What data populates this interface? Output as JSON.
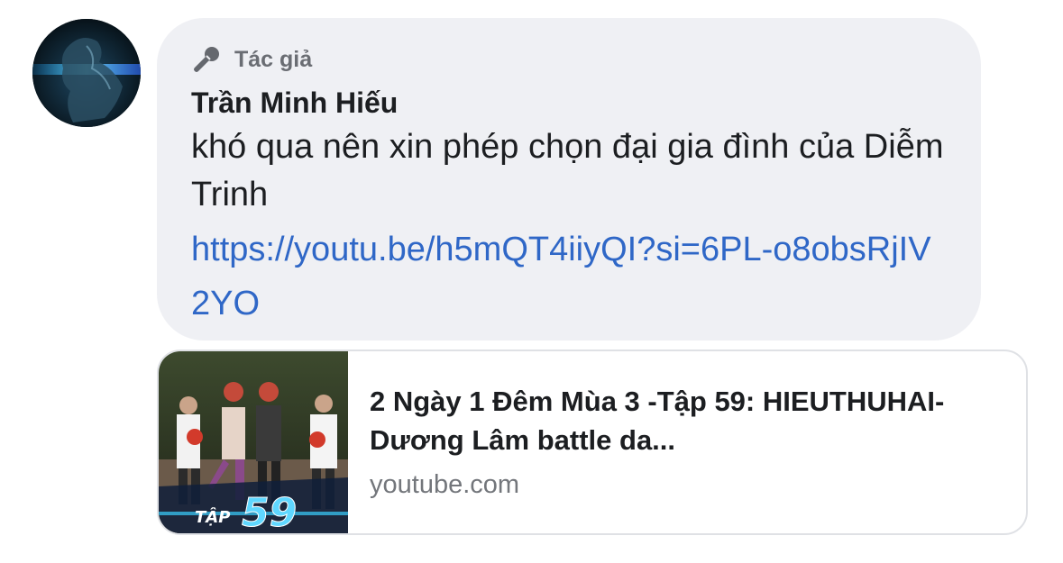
{
  "comment": {
    "badge_label": "Tác giả",
    "author_name": "Trần Minh Hiếu",
    "message": "khó qua nên xin phép chọn đại gia đình của Diễm Trinh",
    "link": "https://youtu.be/h5mQT4iiyQI?si=6PL-o8obsRjIV2YO"
  },
  "preview": {
    "title": "2 Ngày 1 Đêm Mùa 3 -Tập 59: HIEUTHUHAI-Dương Lâm battle da...",
    "source": "youtube.com",
    "thumbnail_text_small": "TẬP",
    "thumbnail_text_big": "59"
  },
  "colors": {
    "bubble_bg": "#eff0f4",
    "link": "#2f67c7",
    "text_primary": "#1c1e21",
    "text_secondary": "#73767b"
  },
  "icons": [
    "microphone-icon"
  ]
}
